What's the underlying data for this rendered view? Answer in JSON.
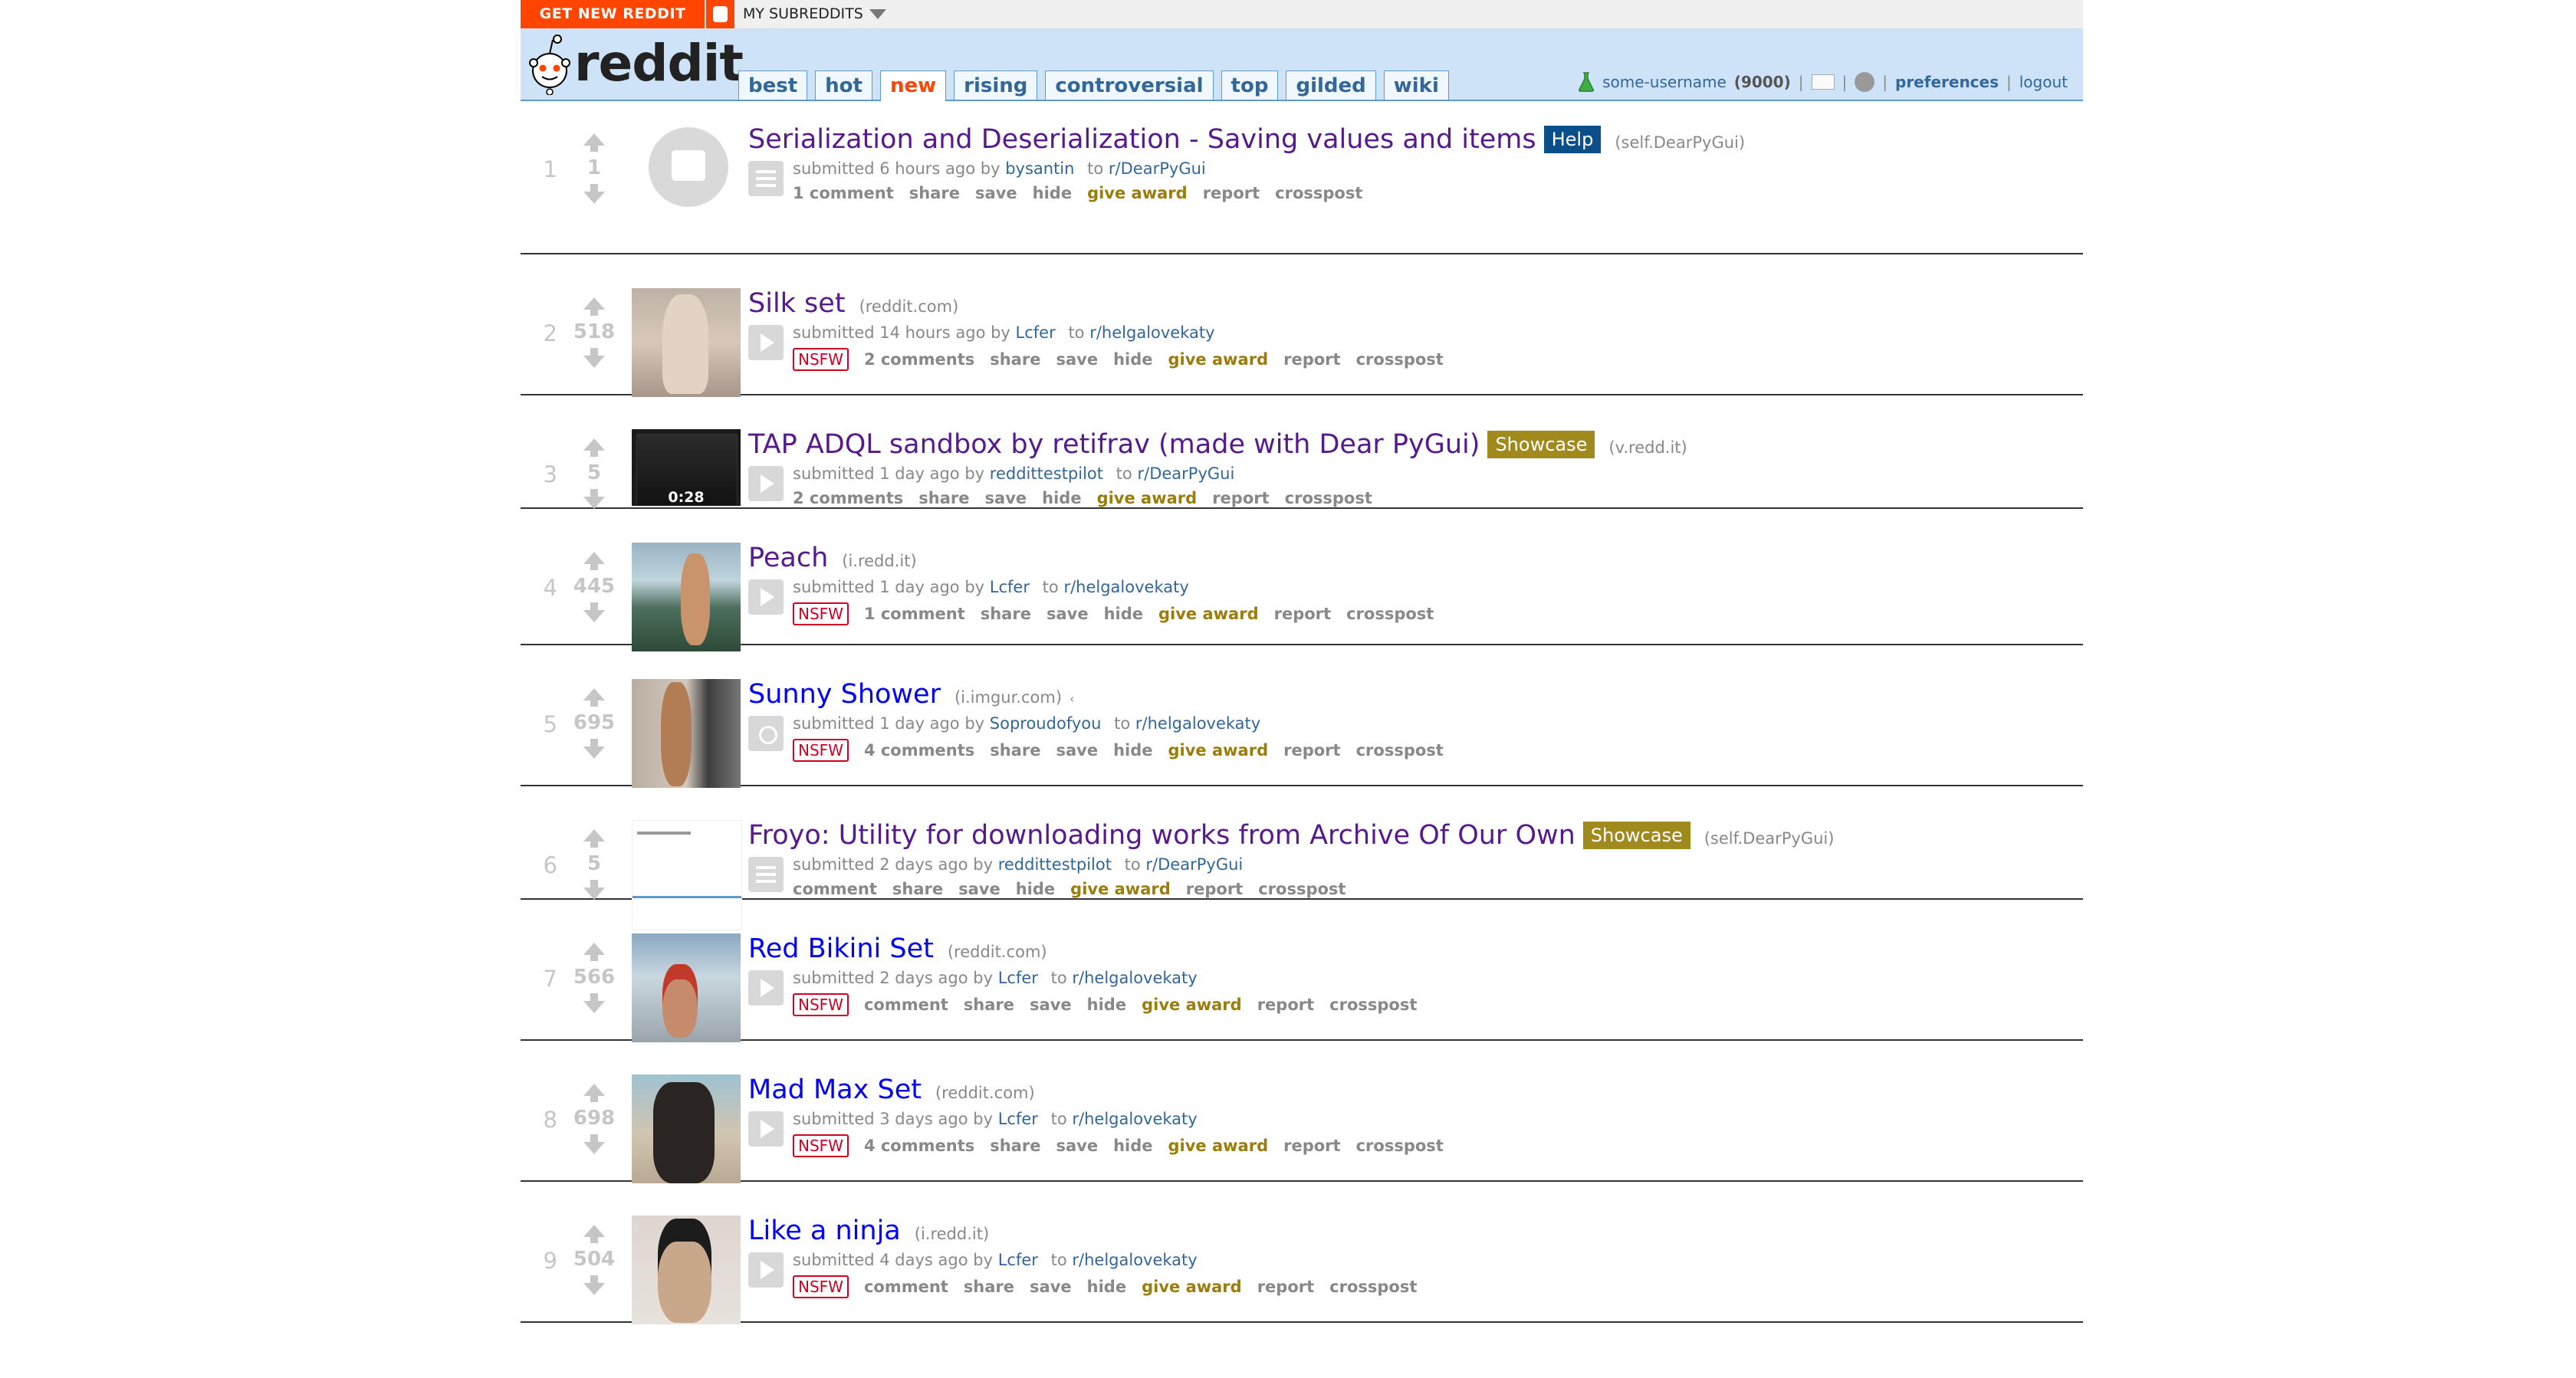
{
  "topbar": {
    "get_new_reddit": "GET NEW REDDIT",
    "my_subreddits": "MY SUBREDDITS"
  },
  "header": {
    "wordmark": "reddit",
    "tabs": [
      "best",
      "hot",
      "new",
      "rising",
      "controversial",
      "top",
      "gilded",
      "wiki"
    ],
    "selected_tab": "new",
    "username": "some-username",
    "karma": "(9000)",
    "preferences": "preferences",
    "logout": "logout",
    "separator": "|"
  },
  "colors": {
    "orange_accent": "#ff4500",
    "header_blue": "#cee3f8",
    "link_blue": "#336699",
    "visited_purple": "#551a8b",
    "nsfw_red": "#d10023",
    "give_award_gold": "#9a7d0a"
  },
  "posts": [
    {
      "rank": "1",
      "score": "1",
      "title": "Serialization and Deserialization - Saving values and items",
      "flair": "Help",
      "domain": "(self.DearPyGui)",
      "submitted": "submitted 6 hours ago by",
      "author": "bysantin",
      "to": "to",
      "subreddit": "r/DearPyGui",
      "nsfw": "",
      "comments": "1 comment",
      "thumb": "self",
      "expando": "text"
    },
    {
      "rank": "2",
      "score": "518",
      "title": "Silk set",
      "flair": "",
      "domain": "(reddit.com)",
      "submitted": "submitted 14 hours ago by",
      "author": "Lcfer",
      "to": "to",
      "subreddit": "r/helgalovekaty",
      "nsfw": "NSFW",
      "comments": "2 comments",
      "thumb": "silk",
      "expando": "play"
    },
    {
      "rank": "3",
      "score": "5",
      "title": "TAP ADQL sandbox by retifrav (made with Dear PyGui)",
      "flair": "Showcase",
      "domain": "(v.redd.it)",
      "submitted": "submitted 1 day ago by",
      "author": "reddittestpilot",
      "to": "to",
      "subreddit": "r/DearPyGui",
      "nsfw": "",
      "comments": "2 comments",
      "thumb": "vid",
      "video_time": "0:28",
      "expando": "play"
    },
    {
      "rank": "4",
      "score": "445",
      "title": "Peach",
      "flair": "",
      "domain": "(i.redd.it)",
      "submitted": "submitted 1 day ago by",
      "author": "Lcfer",
      "to": "to",
      "subreddit": "r/helgalovekaty",
      "nsfw": "NSFW",
      "comments": "1 comment",
      "thumb": "peach",
      "expando": "play"
    },
    {
      "rank": "5",
      "score": "695",
      "title": "Sunny Shower",
      "flair": "",
      "domain": "(i.imgur.com)",
      "submitted": "submitted 1 day ago by",
      "author": "Soproudofyou",
      "to": "to",
      "subreddit": "r/helgalovekaty",
      "nsfw": "NSFW",
      "comments": "4 comments",
      "thumb": "sunny",
      "expando": "share",
      "unvisited": true
    },
    {
      "rank": "6",
      "score": "5",
      "title": "Froyo: Utility for downloading works from Archive Of Our Own",
      "flair": "Showcase",
      "domain": "(self.DearPyGui)",
      "submitted": "submitted 2 days ago by",
      "author": "reddittestpilot",
      "to": "to",
      "subreddit": "r/DearPyGui",
      "nsfw": "",
      "comments": "comment",
      "thumb": "froyo",
      "expando": "text"
    },
    {
      "rank": "7",
      "score": "566",
      "title": "Red Bikini Set",
      "flair": "",
      "domain": "(reddit.com)",
      "submitted": "submitted 2 days ago by",
      "author": "Lcfer",
      "to": "to",
      "subreddit": "r/helgalovekaty",
      "nsfw": "NSFW",
      "comments": "comment",
      "thumb": "redbikini",
      "expando": "play",
      "unvisited": true
    },
    {
      "rank": "8",
      "score": "698",
      "title": "Mad Max Set",
      "flair": "",
      "domain": "(reddit.com)",
      "submitted": "submitted 3 days ago by",
      "author": "Lcfer",
      "to": "to",
      "subreddit": "r/helgalovekaty",
      "nsfw": "NSFW",
      "comments": "4 comments",
      "thumb": "madmax",
      "expando": "play",
      "unvisited": true
    },
    {
      "rank": "9",
      "score": "504",
      "title": "Like a ninja",
      "flair": "",
      "domain": "(i.redd.it)",
      "submitted": "submitted 4 days ago by",
      "author": "Lcfer",
      "to": "to",
      "subreddit": "r/helgalovekaty",
      "nsfw": "NSFW",
      "comments": "comment",
      "thumb": "ninja",
      "expando": "play",
      "unvisited": true
    }
  ],
  "actions": {
    "share": "share",
    "save": "save",
    "hide": "hide",
    "give_award": "give award",
    "report": "report",
    "crosspost": "crosspost"
  },
  "icons": {
    "upvote": "arrow-up",
    "downvote": "arrow-down",
    "self_post": "text-lines",
    "media": "play-triangle",
    "crosspost_link": "share-nodes",
    "mail": "envelope",
    "chat": "chat-bubble",
    "beta": "flask"
  }
}
